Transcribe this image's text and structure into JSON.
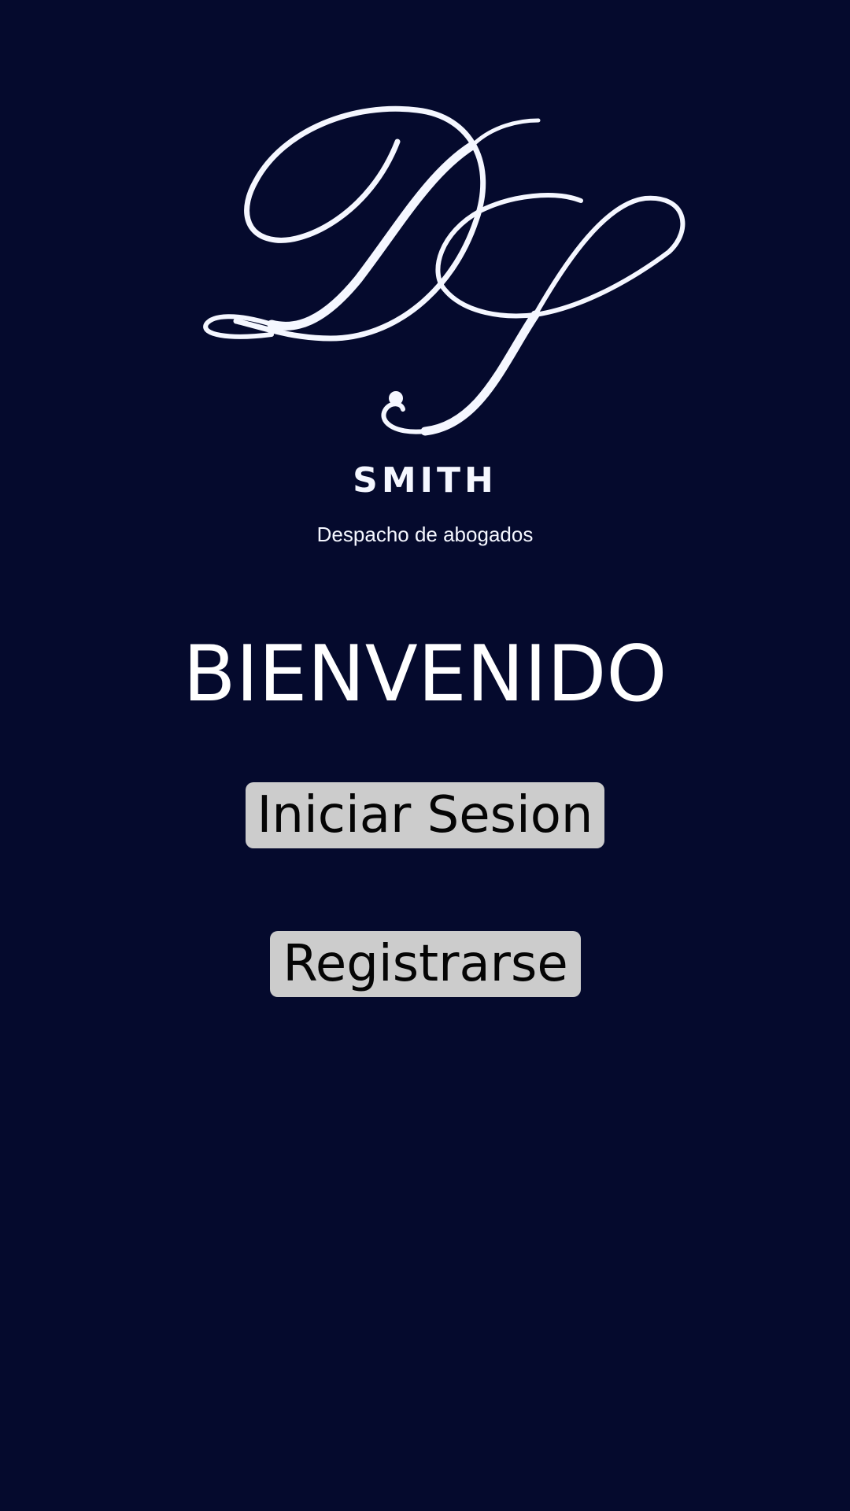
{
  "colors": {
    "background": "#050a2d",
    "logo": "#f5f7ff",
    "button_background": "#cccccc",
    "button_text": "#050505"
  },
  "logo": {
    "icon": "ds-monogram-logo",
    "letters": "DS"
  },
  "brand": {
    "name": "SMITH",
    "tagline": "Despacho de abogados"
  },
  "welcome": {
    "title": "BIENVENIDO"
  },
  "actions": {
    "login_label": "Iniciar Sesion",
    "register_label": "Registrarse"
  }
}
